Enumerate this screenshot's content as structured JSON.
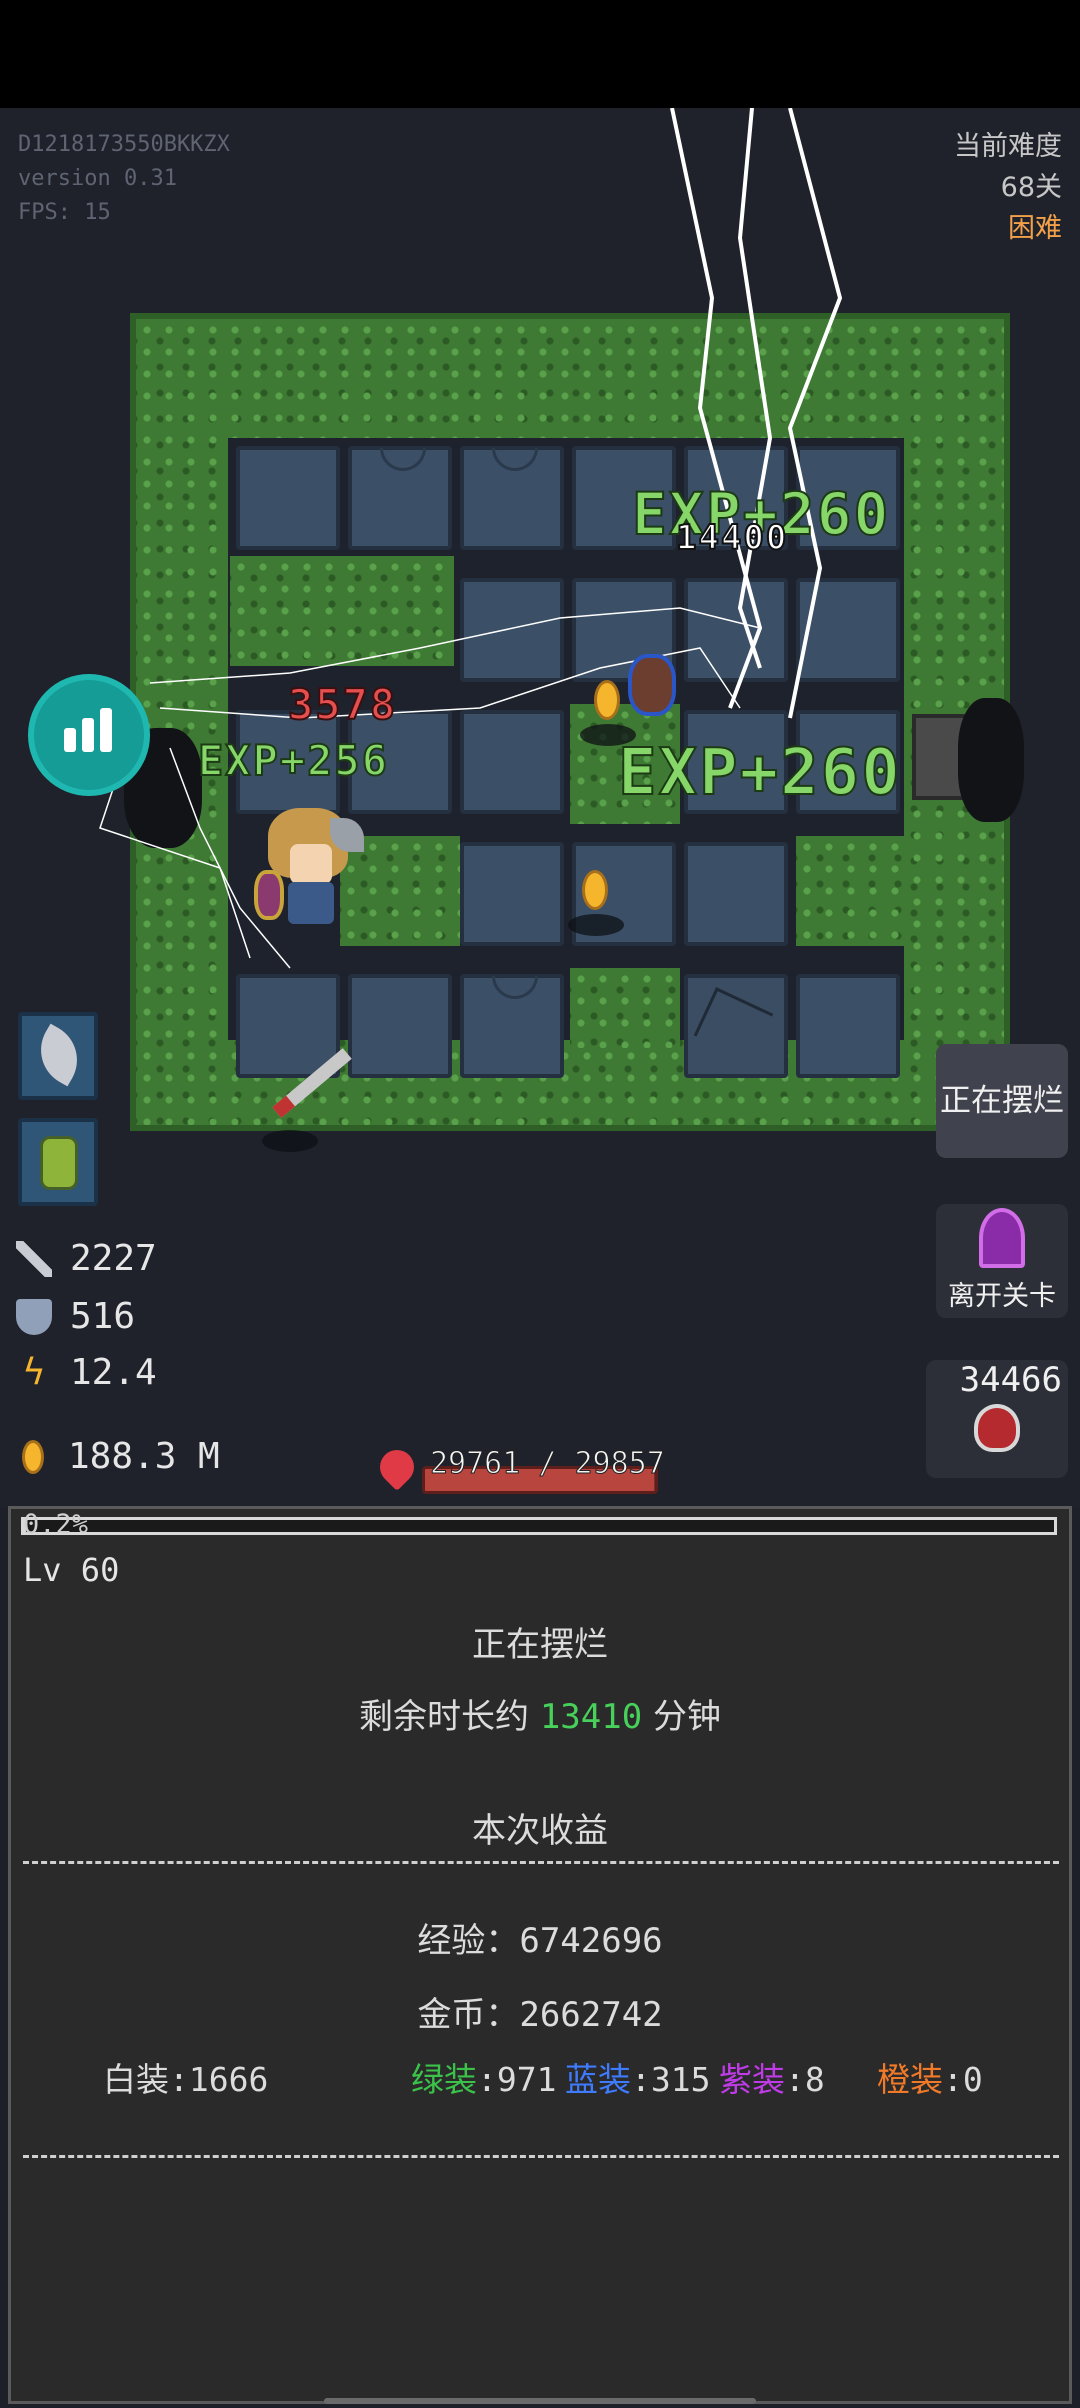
{
  "meta": {
    "device_id": "D1218173550BKKZX",
    "version": "version 0.31",
    "fps": "FPS: 15"
  },
  "difficulty": {
    "label": "当前难度",
    "stage": "68关",
    "level": "困难"
  },
  "floating_texts": [
    {
      "text": "EXP+260",
      "kind": "exp"
    },
    {
      "text": "14400",
      "kind": "white"
    },
    {
      "text": "3578",
      "kind": "dmg"
    },
    {
      "text": "EXP+256",
      "kind": "exp"
    },
    {
      "text": "EXP+260",
      "kind": "exp"
    }
  ],
  "stats": {
    "attack": "2227",
    "defense": "516",
    "speed": "12.4",
    "gold": "188.3 M"
  },
  "hp": {
    "text": "29761 / 29857",
    "current": 29761,
    "max": 29857
  },
  "right_buttons": {
    "idle": "正在摆烂",
    "leave": "离开关卡",
    "potion_count": "34466"
  },
  "colors": {
    "accent_teal": "#159c97",
    "exp_green": "#86d66a",
    "green_count": "#47d15a"
  },
  "panel": {
    "progress_text": "0.2%",
    "progress": 0.002,
    "level": "Lv 60",
    "status": "正在摆烂",
    "remaining_prefix": "剩余时长约",
    "remaining_value": "13410",
    "remaining_unit": "分钟",
    "earnings_title": "本次收益",
    "exp_label": "经验：",
    "exp_value": "6742696",
    "gold_label": "金币：",
    "gold_value": "2662742",
    "equip": [
      {
        "label": "白装",
        "count": ":1666",
        "color": "#dcdcdc"
      },
      {
        "label": "绿装",
        "count": ":971",
        "color": "#3bc24a"
      },
      {
        "label": "蓝装",
        "count": ":315",
        "color": "#3f7bff"
      },
      {
        "label": "紫装",
        "count": ":8",
        "color": "#c03be8"
      },
      {
        "label": "橙装",
        "count": ":0",
        "color": "#f07a2a"
      }
    ]
  }
}
